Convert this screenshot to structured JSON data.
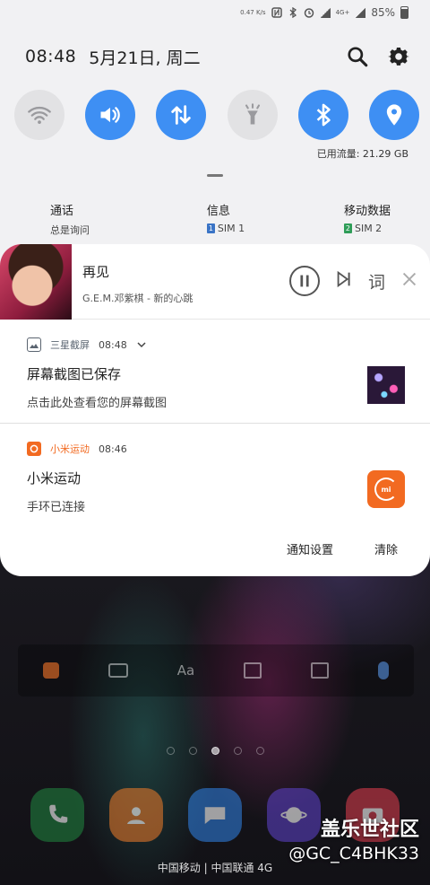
{
  "status_bar": {
    "net_speed": "0.47 K/s",
    "battery_percent": "85%",
    "network": "4G+"
  },
  "header": {
    "time": "08:48",
    "date": "5月21日, 周二"
  },
  "quick_toggles": [
    {
      "name": "wifi",
      "on": false
    },
    {
      "name": "sound",
      "on": true
    },
    {
      "name": "mobile-data",
      "on": true
    },
    {
      "name": "flashlight",
      "on": false
    },
    {
      "name": "bluetooth",
      "on": true
    },
    {
      "name": "location",
      "on": true
    }
  ],
  "data_usage": "已用流量: 21.29 GB",
  "sim_settings": {
    "call": {
      "title": "通话",
      "value": "总是询问"
    },
    "message": {
      "title": "信息",
      "sim_badge": "1",
      "value": "SIM 1"
    },
    "mobile_data": {
      "title": "移动数据",
      "sim_badge": "2",
      "value": "SIM 2"
    }
  },
  "media": {
    "song": "再见",
    "artist_album": "G.E.M.邓紫棋 - 新的心跳",
    "lyrics_label": "词"
  },
  "notifications": [
    {
      "app": "三星截屏",
      "time": "08:48",
      "title": "屏幕截图已保存",
      "body": "点击此处查看您的屏幕截图",
      "app_color": "#5a6470"
    },
    {
      "app": "小米运动",
      "time": "08:46",
      "title": "小米运动",
      "body": "手环已连接",
      "app_color": "#f26a21"
    }
  ],
  "footer": {
    "settings_label": "通知设置",
    "clear_label": "清除"
  },
  "home_screen": {
    "carrier_text": "中国移动 | 中国联通 4G",
    "watermark_title": "盖乐世社区",
    "watermark_user": "@GC_C4BHK33",
    "widget_aa": "Aa"
  },
  "colors": {
    "toggle_on": "#3e8ff3",
    "toggle_off": "#e2e2e4",
    "panel_bg": "#f1f1f3",
    "mi_orange": "#f26a21"
  }
}
